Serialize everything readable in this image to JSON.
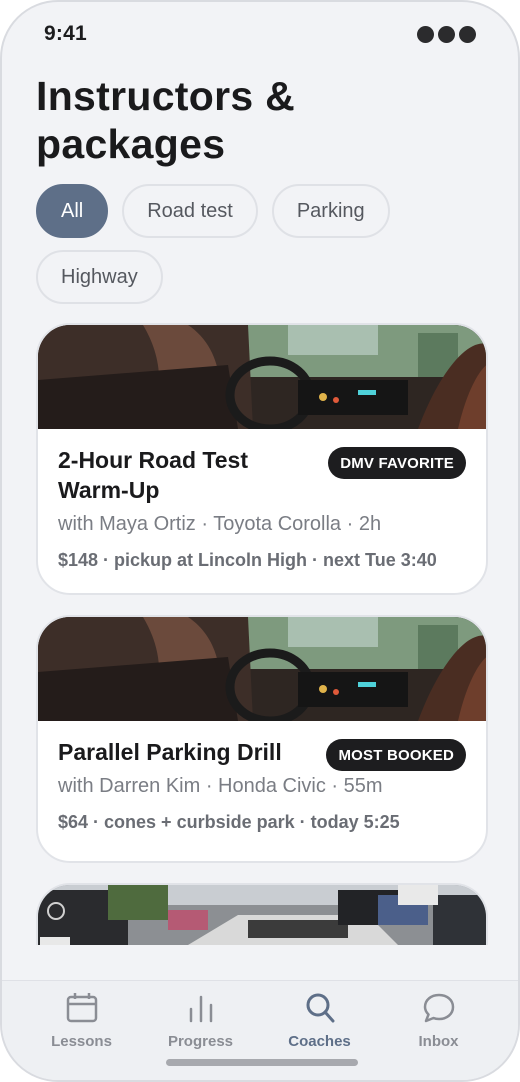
{
  "status": {
    "time": "9:41"
  },
  "page": {
    "title": "Instructors & packages"
  },
  "filters": [
    {
      "label": "All",
      "active": true
    },
    {
      "label": "Road test",
      "active": false
    },
    {
      "label": "Parking",
      "active": false
    },
    {
      "label": "Highway",
      "active": false
    }
  ],
  "cards": [
    {
      "title": "2-Hour Road Test Warm-Up",
      "badge": "DMV FAVORITE",
      "subtitle": "with Maya Ortiz · Toyota Corolla · 2h",
      "meta": "$148 · pickup at Lincoln High · next Tue 3:40"
    },
    {
      "title": "Parallel Parking Drill",
      "badge": "MOST BOOKED",
      "subtitle": "with Darren Kim · Honda Civic · 55m",
      "meta": "$64 · cones + curbside park · today 5:25"
    }
  ],
  "tabs": [
    {
      "label": "Lessons",
      "icon": "calendar-icon",
      "active": false
    },
    {
      "label": "Progress",
      "icon": "bar-chart-icon",
      "active": false
    },
    {
      "label": "Coaches",
      "icon": "search-icon",
      "active": true
    },
    {
      "label": "Inbox",
      "icon": "chat-bubble-icon",
      "active": false
    }
  ],
  "colors": {
    "accent": "#5e6f88",
    "badge": "#1d1d1f",
    "background": "#f2f3f6"
  }
}
